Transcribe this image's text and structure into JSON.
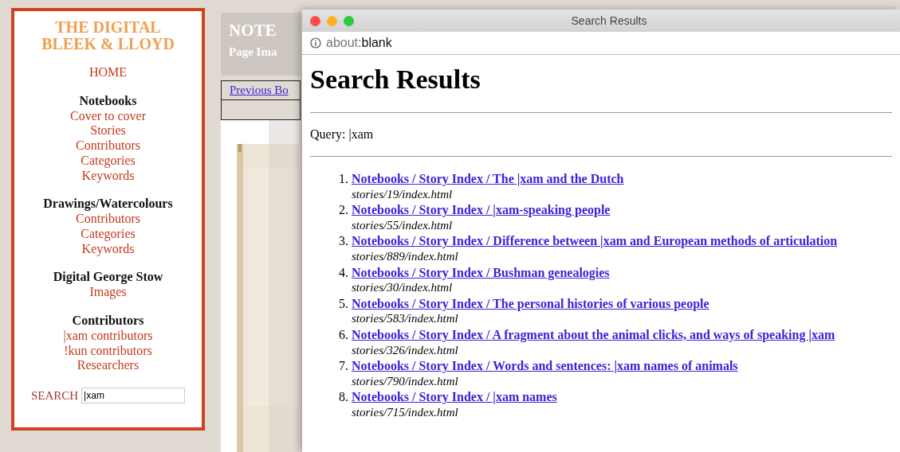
{
  "sidebar": {
    "title_lines": [
      "THE DIGITAL",
      "BLEEK & LLOYD"
    ],
    "home": "HOME",
    "sections": [
      {
        "heading": "Notebooks",
        "links": [
          "Cover to cover",
          "Stories",
          "Contributors",
          "Categories",
          "Keywords"
        ]
      },
      {
        "heading": "Drawings/Watercolours",
        "links": [
          "Contributors",
          "Categories",
          "Keywords"
        ]
      },
      {
        "heading": "Digital George Stow",
        "links": [
          "Images"
        ]
      },
      {
        "heading": "Contributors",
        "links": [
          "|xam contributors",
          "!kun contributors",
          "Researchers"
        ]
      }
    ],
    "search": {
      "label": "SEARCH",
      "value": "|xam"
    }
  },
  "page": {
    "header_title": "NOTE",
    "header_subtitle": "Page Ima",
    "nav_link": "Previous Bo"
  },
  "popup": {
    "window": {
      "title": "Search Results"
    },
    "address": {
      "scheme": "about:",
      "rest": "blank"
    },
    "heading": "Search Results",
    "query": "Query: |xam",
    "results": [
      {
        "number": "1.",
        "title": "Notebooks / Story Index / The |xam and the Dutch",
        "path": "stories/19/index.html"
      },
      {
        "number": "2.",
        "title": "Notebooks / Story Index / |xam-speaking people",
        "path": "stories/55/index.html"
      },
      {
        "number": "3.",
        "title": "Notebooks / Story Index / Difference between |xam and European methods of articulation",
        "path": "stories/889/index.html"
      },
      {
        "number": "4.",
        "title": "Notebooks / Story Index / Bushman genealogies",
        "path": "stories/30/index.html"
      },
      {
        "number": "5.",
        "title": "Notebooks / Story Index / The personal histories of various people",
        "path": "stories/583/index.html"
      },
      {
        "number": "6.",
        "title": "Notebooks / Story Index / A fragment about the animal clicks, and ways of speaking |xam",
        "path": "stories/326/index.html"
      },
      {
        "number": "7.",
        "title": "Notebooks / Story Index / Words and sentences: |xam names of animals",
        "path": "stories/790/index.html"
      },
      {
        "number": "8.",
        "title": "Notebooks / Story Index / |xam names",
        "path": "stories/715/index.html"
      }
    ]
  }
}
